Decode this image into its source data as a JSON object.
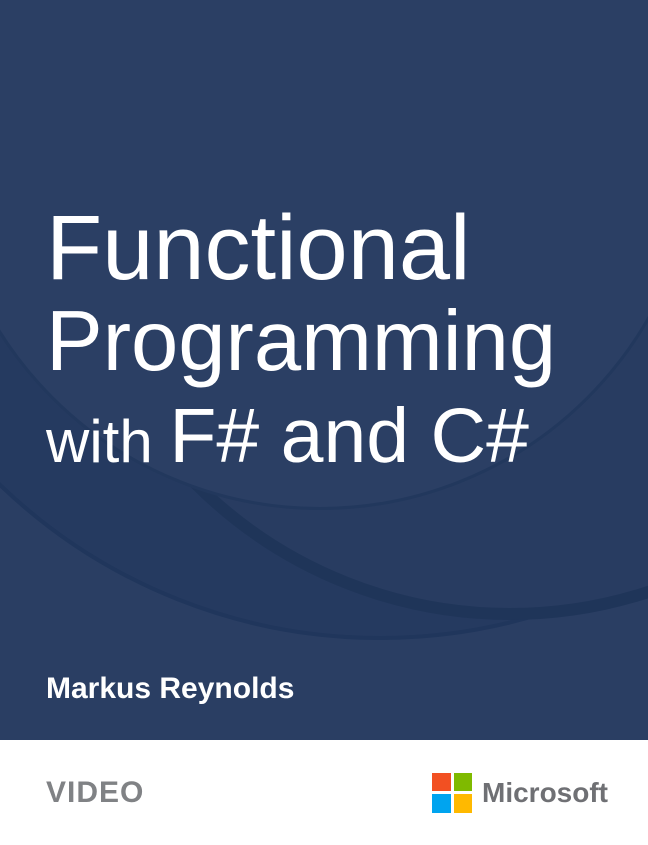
{
  "title": {
    "line1": "Functional",
    "line2": "Programming",
    "line3_prefix": "with ",
    "line3_main": "F# and C#"
  },
  "author": "Markus Reynolds",
  "footer": {
    "video_label": "VIDEO",
    "publisher": "Microsoft"
  },
  "colors": {
    "ms_red": "#f25022",
    "ms_green": "#7fba00",
    "ms_blue": "#00a4ef",
    "ms_yellow": "#ffb900"
  }
}
